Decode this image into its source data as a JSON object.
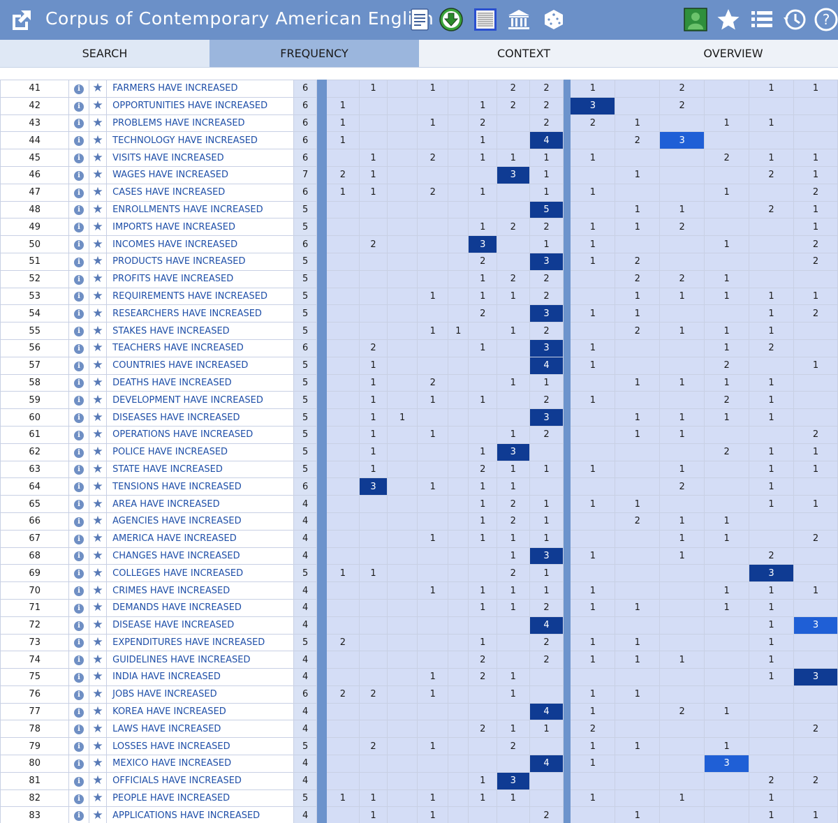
{
  "header": {
    "title": "Corpus of Contemporary American English",
    "icons": [
      "external-link-icon",
      "document-icon",
      "download-icon",
      "texts-icon",
      "library-icon",
      "dice-icon",
      "user-icon",
      "star-icon",
      "list-icon",
      "history-icon",
      "help-icon"
    ]
  },
  "tabs": [
    {
      "label": "SEARCH"
    },
    {
      "label": "FREQUENCY"
    },
    {
      "label": "CONTEXT"
    },
    {
      "label": "OVERVIEW"
    }
  ],
  "colors": {
    "header_bg": "#6b90c8",
    "active_tab": "#9bb6dd",
    "cell_bg": "#d4ddf6",
    "highlight_dark": "#0f3b93",
    "highlight_bright": "#1f5fd6",
    "link": "#1f4fa8"
  },
  "rows": [
    {
      "rank": "41",
      "phrase": "FARMERS HAVE INCREASED",
      "freq": "6",
      "a": [
        "",
        "1",
        "",
        "1",
        "",
        "2",
        "2"
      ],
      "b": [
        "1",
        "",
        "2",
        "",
        "1",
        "1"
      ]
    },
    {
      "rank": "42",
      "phrase": "OPPORTUNITIES HAVE INCREASED",
      "freq": "6",
      "a": [
        "1",
        "",
        "",
        "",
        "1",
        "2",
        "2"
      ],
      "b": [
        "3*",
        "",
        "2",
        "",
        "",
        ""
      ]
    },
    {
      "rank": "43",
      "phrase": "PROBLEMS HAVE INCREASED",
      "freq": "6",
      "a": [
        "1",
        "",
        "",
        "1",
        "2",
        "",
        "2"
      ],
      "b": [
        "2",
        "1",
        "",
        "1",
        "1",
        ""
      ]
    },
    {
      "rank": "44",
      "phrase": "TECHNOLOGY HAVE INCREASED",
      "freq": "6",
      "a": [
        "1",
        "",
        "",
        "",
        "1",
        "",
        "4*"
      ],
      "b": [
        "",
        "2",
        "3+",
        "",
        "",
        ""
      ]
    },
    {
      "rank": "45",
      "phrase": "VISITS HAVE INCREASED",
      "freq": "6",
      "a": [
        "",
        "1",
        "",
        "2",
        "1",
        "1",
        "1"
      ],
      "b": [
        "1",
        "",
        "",
        "2",
        "1",
        "1"
      ]
    },
    {
      "rank": "46",
      "phrase": "WAGES HAVE INCREASED",
      "freq": "7",
      "a": [
        "2",
        "1",
        "",
        "",
        "",
        "3*",
        "1"
      ],
      "b": [
        "",
        "1",
        "",
        "",
        "2",
        "1"
      ]
    },
    {
      "rank": "47",
      "phrase": "CASES HAVE INCREASED",
      "freq": "6",
      "a": [
        "1",
        "1",
        "",
        "2",
        "1",
        "",
        "1"
      ],
      "b": [
        "1",
        "",
        "",
        "1",
        "",
        "2"
      ]
    },
    {
      "rank": "48",
      "phrase": "ENROLLMENTS HAVE INCREASED",
      "freq": "5",
      "a": [
        "",
        "",
        "",
        "",
        "",
        "",
        "5*"
      ],
      "b": [
        "",
        "1",
        "1",
        "",
        "2",
        "1"
      ]
    },
    {
      "rank": "49",
      "phrase": "IMPORTS HAVE INCREASED",
      "freq": "5",
      "a": [
        "",
        "",
        "",
        "",
        "1",
        "2",
        "2"
      ],
      "b": [
        "1",
        "1",
        "2",
        "",
        "",
        "1"
      ]
    },
    {
      "rank": "50",
      "phrase": "INCOMES HAVE INCREASED",
      "freq": "6",
      "a": [
        "",
        "2",
        "",
        "",
        "3*",
        "",
        "1"
      ],
      "b": [
        "1",
        "",
        "",
        "1",
        "",
        "2"
      ]
    },
    {
      "rank": "51",
      "phrase": "PRODUCTS HAVE INCREASED",
      "freq": "5",
      "a": [
        "",
        "",
        "",
        "",
        "2",
        "",
        "3*"
      ],
      "b": [
        "1",
        "2",
        "",
        "",
        "",
        "2"
      ]
    },
    {
      "rank": "52",
      "phrase": "PROFITS HAVE INCREASED",
      "freq": "5",
      "a": [
        "",
        "",
        "",
        "",
        "1",
        "2",
        "2"
      ],
      "b": [
        "",
        "2",
        "2",
        "1",
        "",
        ""
      ]
    },
    {
      "rank": "53",
      "phrase": "REQUIREMENTS HAVE INCREASED",
      "freq": "5",
      "a": [
        "",
        "",
        "",
        "1",
        "1",
        "1",
        "2"
      ],
      "b": [
        "",
        "1",
        "1",
        "1",
        "1",
        "1"
      ]
    },
    {
      "rank": "54",
      "phrase": "RESEARCHERS HAVE INCREASED",
      "freq": "5",
      "a": [
        "",
        "",
        "",
        "",
        "2",
        "",
        "3*"
      ],
      "b": [
        "1",
        "1",
        "",
        "",
        "1",
        "2"
      ]
    },
    {
      "rank": "55",
      "phrase": "STAKES HAVE INCREASED",
      "freq": "5",
      "a": [
        "",
        "",
        "",
        "1",
        "",
        "1",
        "2"
      ],
      "b": [
        "",
        "2",
        "1",
        "1",
        "1",
        ""
      ],
      "extra": "1"
    },
    {
      "rank": "56",
      "phrase": "TEACHERS HAVE INCREASED",
      "freq": "6",
      "a": [
        "",
        "2",
        "",
        "",
        "1",
        "",
        "3*"
      ],
      "b": [
        "1",
        "",
        "",
        "1",
        "2",
        ""
      ]
    },
    {
      "rank": "57",
      "phrase": "COUNTRIES HAVE INCREASED",
      "freq": "5",
      "a": [
        "",
        "1",
        "",
        "",
        "",
        "",
        "4*"
      ],
      "b": [
        "1",
        "",
        "",
        "2",
        "",
        "1"
      ]
    },
    {
      "rank": "58",
      "phrase": "DEATHS HAVE INCREASED",
      "freq": "5",
      "a": [
        "",
        "1",
        "",
        "2",
        "",
        "1",
        "1"
      ],
      "b": [
        "",
        "1",
        "1",
        "1",
        "1",
        ""
      ]
    },
    {
      "rank": "59",
      "phrase": "DEVELOPMENT HAVE INCREASED",
      "freq": "5",
      "a": [
        "",
        "1",
        "",
        "1",
        "1",
        "",
        "2"
      ],
      "b": [
        "1",
        "",
        "",
        "2",
        "1",
        ""
      ]
    },
    {
      "rank": "60",
      "phrase": "DISEASES HAVE INCREASED",
      "freq": "5",
      "a": [
        "",
        "1",
        "1",
        "",
        "",
        "",
        "3*"
      ],
      "b": [
        "",
        "1",
        "1",
        "1",
        "1",
        ""
      ]
    },
    {
      "rank": "61",
      "phrase": "OPERATIONS HAVE INCREASED",
      "freq": "5",
      "a": [
        "",
        "1",
        "",
        "1",
        "",
        "1",
        "2"
      ],
      "b": [
        "",
        "1",
        "1",
        "",
        "",
        "2"
      ]
    },
    {
      "rank": "62",
      "phrase": "POLICE HAVE INCREASED",
      "freq": "5",
      "a": [
        "",
        "1",
        "",
        "",
        "1",
        "3*",
        ""
      ],
      "b": [
        "",
        "",
        "",
        "2",
        "1",
        "1"
      ]
    },
    {
      "rank": "63",
      "phrase": "STATE HAVE INCREASED",
      "freq": "5",
      "a": [
        "",
        "1",
        "",
        "",
        "2",
        "1",
        "1"
      ],
      "b": [
        "1",
        "",
        "1",
        "",
        "1",
        "1"
      ]
    },
    {
      "rank": "64",
      "phrase": "TENSIONS HAVE INCREASED",
      "freq": "6",
      "a": [
        "",
        "3*",
        "",
        "1",
        "1",
        "1",
        ""
      ],
      "b": [
        "",
        "",
        "2",
        "",
        "1",
        ""
      ]
    },
    {
      "rank": "65",
      "phrase": "AREA HAVE INCREASED",
      "freq": "4",
      "a": [
        "",
        "",
        "",
        "",
        "1",
        "2",
        "1"
      ],
      "b": [
        "1",
        "1",
        "",
        "",
        "1",
        "1"
      ]
    },
    {
      "rank": "66",
      "phrase": "AGENCIES HAVE INCREASED",
      "freq": "4",
      "a": [
        "",
        "",
        "",
        "",
        "1",
        "2",
        "1"
      ],
      "b": [
        "",
        "2",
        "1",
        "1",
        "",
        ""
      ]
    },
    {
      "rank": "67",
      "phrase": "AMERICA HAVE INCREASED",
      "freq": "4",
      "a": [
        "",
        "",
        "",
        "1",
        "1",
        "1",
        "1"
      ],
      "b": [
        "",
        "",
        "1",
        "1",
        "",
        "2"
      ]
    },
    {
      "rank": "68",
      "phrase": "CHANGES HAVE INCREASED",
      "freq": "4",
      "a": [
        "",
        "",
        "",
        "",
        "",
        "1",
        "3*"
      ],
      "b": [
        "1",
        "",
        "1",
        "",
        "2",
        ""
      ]
    },
    {
      "rank": "69",
      "phrase": "COLLEGES HAVE INCREASED",
      "freq": "5",
      "a": [
        "1",
        "1",
        "",
        "",
        "",
        "2",
        "1"
      ],
      "b": [
        "",
        "",
        "",
        "",
        "3*",
        ""
      ]
    },
    {
      "rank": "70",
      "phrase": "CRIMES HAVE INCREASED",
      "freq": "4",
      "a": [
        "",
        "",
        "",
        "1",
        "1",
        "1",
        "1"
      ],
      "b": [
        "1",
        "",
        "",
        "1",
        "1",
        "1"
      ]
    },
    {
      "rank": "71",
      "phrase": "DEMANDS HAVE INCREASED",
      "freq": "4",
      "a": [
        "",
        "",
        "",
        "",
        "1",
        "1",
        "2"
      ],
      "b": [
        "1",
        "1",
        "",
        "1",
        "1",
        ""
      ]
    },
    {
      "rank": "72",
      "phrase": "DISEASE HAVE INCREASED",
      "freq": "4",
      "a": [
        "",
        "",
        "",
        "",
        "",
        "",
        "4*"
      ],
      "b": [
        "",
        "",
        "",
        "",
        "1",
        "3+"
      ]
    },
    {
      "rank": "73",
      "phrase": "EXPENDITURES HAVE INCREASED",
      "freq": "5",
      "a": [
        "2",
        "",
        "",
        "",
        "1",
        "",
        "2"
      ],
      "b": [
        "1",
        "1",
        "",
        "",
        "1",
        ""
      ]
    },
    {
      "rank": "74",
      "phrase": "GUIDELINES HAVE INCREASED",
      "freq": "4",
      "a": [
        "",
        "",
        "",
        "",
        "2",
        "",
        "2"
      ],
      "b": [
        "1",
        "1",
        "1",
        "",
        "1",
        ""
      ]
    },
    {
      "rank": "75",
      "phrase": "INDIA HAVE INCREASED",
      "freq": "4",
      "a": [
        "",
        "",
        "",
        "1",
        "2",
        "1",
        ""
      ],
      "b": [
        "",
        "",
        "",
        "",
        "1",
        "3*"
      ]
    },
    {
      "rank": "76",
      "phrase": "JOBS HAVE INCREASED",
      "freq": "6",
      "a": [
        "2",
        "2",
        "",
        "1",
        "",
        "1",
        ""
      ],
      "b": [
        "1",
        "1",
        "",
        "",
        "",
        ""
      ]
    },
    {
      "rank": "77",
      "phrase": "KOREA HAVE INCREASED",
      "freq": "4",
      "a": [
        "",
        "",
        "",
        "",
        "",
        "",
        "4*"
      ],
      "b": [
        "1",
        "",
        "2",
        "1",
        "",
        ""
      ]
    },
    {
      "rank": "78",
      "phrase": "LAWS HAVE INCREASED",
      "freq": "4",
      "a": [
        "",
        "",
        "",
        "",
        "2",
        "1",
        "1"
      ],
      "b": [
        "2",
        "",
        "",
        "",
        "",
        "2"
      ]
    },
    {
      "rank": "79",
      "phrase": "LOSSES HAVE INCREASED",
      "freq": "5",
      "a": [
        "",
        "2",
        "",
        "1",
        "",
        "2",
        ""
      ],
      "b": [
        "1",
        "1",
        "",
        "1",
        "",
        ""
      ]
    },
    {
      "rank": "80",
      "phrase": "MEXICO HAVE INCREASED",
      "freq": "4",
      "a": [
        "",
        "",
        "",
        "",
        "",
        "",
        "4*"
      ],
      "b": [
        "1",
        "",
        "",
        "3+",
        "",
        ""
      ]
    },
    {
      "rank": "81",
      "phrase": "OFFICIALS HAVE INCREASED",
      "freq": "4",
      "a": [
        "",
        "",
        "",
        "",
        "1",
        "3*",
        ""
      ],
      "b": [
        "",
        "",
        "",
        "",
        "2",
        "2"
      ]
    },
    {
      "rank": "82",
      "phrase": "PEOPLE HAVE INCREASED",
      "freq": "5",
      "a": [
        "1",
        "1",
        "",
        "1",
        "1",
        "1",
        ""
      ],
      "b": [
        "1",
        "",
        "1",
        "",
        "1",
        ""
      ]
    },
    {
      "rank": "83",
      "phrase": "APPLICATIONS HAVE INCREASED",
      "freq": "4",
      "a": [
        "",
        "1",
        "",
        "1",
        "",
        "",
        "2"
      ],
      "b": [
        "",
        "1",
        "",
        "",
        "1",
        "1"
      ]
    }
  ]
}
